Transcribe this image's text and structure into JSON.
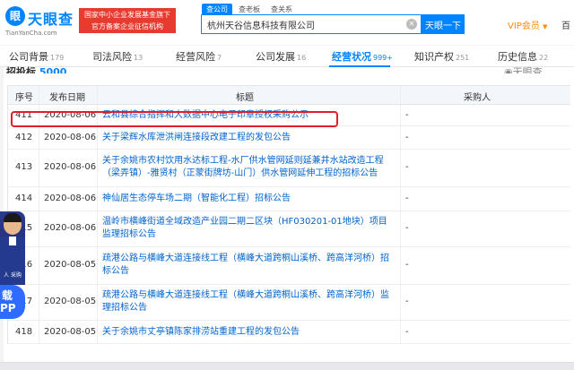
{
  "header": {
    "logo_glyph": "眼",
    "logo_text": "天眼查",
    "logo_sub": "TianYanCha.com",
    "gov_line1": "国家中小企业发展基金旗下",
    "gov_line2": "官方备案企业征信机构",
    "search_tabs": [
      "查公司",
      "查老板",
      "查关系"
    ],
    "search_value": "杭州天谷信息科技有限公司",
    "clear_glyph": "×",
    "search_button": "天眼一下",
    "vip_label": "VIP会员",
    "vip_arrow": "▼",
    "nav_cut": "百"
  },
  "nav": [
    {
      "label": "公司背景",
      "count": "179"
    },
    {
      "label": "司法风险",
      "count": "13"
    },
    {
      "label": "经营风险",
      "count": "7"
    },
    {
      "label": "公司发展",
      "count": "16"
    },
    {
      "label": "经营状况",
      "count": "999+"
    },
    {
      "label": "知识产权",
      "count": "251"
    },
    {
      "label": "历史信息",
      "count": "22"
    }
  ],
  "section": {
    "title": "招投标",
    "count": "5000",
    "brand": "天眼查"
  },
  "table": {
    "columns": [
      "序号",
      "发布日期",
      "标题",
      "采购人"
    ],
    "rows": [
      {
        "no": "411",
        "date": "2020-08-06",
        "title": "云和县综合指挥和大数据中心电子印章授权采购公示",
        "buyer": "-"
      },
      {
        "no": "412",
        "date": "2020-08-06",
        "title": "关于梁辉水库泄洪闸连接段改建工程的发包公告",
        "buyer": "-"
      },
      {
        "no": "413",
        "date": "2020-08-06",
        "title": "关于余姚市农村饮用水达标工程-水厂供水管网延则延兼井水站改造工程（梁弄镇）-雅贤村（正蒙街牌坊-山门）供水管网延伸工程的招标公告",
        "buyer": "-"
      },
      {
        "no": "414",
        "date": "2020-08-06",
        "title": "神仙居生态停车场二期（智能化工程）招标公告",
        "buyer": "-"
      },
      {
        "no": "415",
        "date": "2020-08-06",
        "title": "温岭市横峰街道全域改造产业园二期二区块（HF030201-01地块）项目监理招标公告",
        "buyer": "-"
      },
      {
        "no": "416",
        "date": "2020-08-05",
        "title": "疏港公路与横峰大道连接线工程（横峰大道跨桐山溪桥、跨高洋河桥）招标公告",
        "buyer": "-"
      },
      {
        "no": "417",
        "date": "2020-08-05",
        "title": "疏港公路与横峰大道连接线工程（横峰大道跨桐山溪桥、跨高洋河桥）监理招标公告",
        "buyer": "-"
      },
      {
        "no": "418",
        "date": "2020-08-05",
        "title": "关于余姚市丈亭镇陈家排涝站重建工程的发包公告",
        "buyer": "-"
      }
    ]
  },
  "ad": {
    "small_text": "人 采购",
    "line1": "载",
    "line2": "PP"
  }
}
